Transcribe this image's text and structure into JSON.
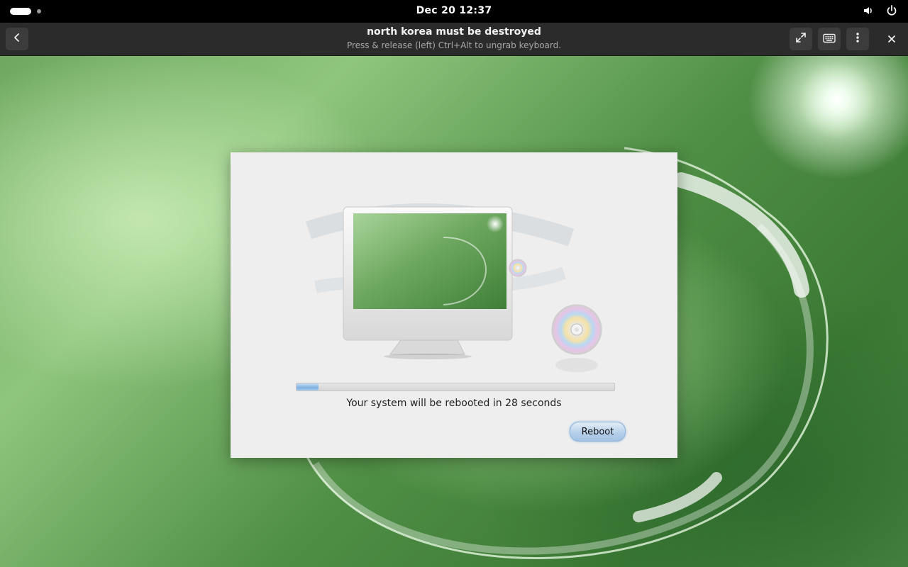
{
  "topbar": {
    "clock": "Dec 20  12:37",
    "icons": [
      "workspace-indicator",
      "volume-icon",
      "power-icon"
    ]
  },
  "headerbar": {
    "title": "north korea must be destroyed",
    "subtitle": "Press & release (left) Ctrl+Alt to ungrab keyboard.",
    "buttons": [
      "back-icon",
      "fullscreen-icon",
      "keyboard-icon",
      "menu-icon",
      "close-icon"
    ]
  },
  "dialog": {
    "progress_fraction": 0.07,
    "status": "Your system will be rebooted in 28 seconds",
    "reboot_label": "Reboot"
  },
  "colors": {
    "accent": "#7fb0e0",
    "wallpaper_green": "#5f9e52"
  }
}
